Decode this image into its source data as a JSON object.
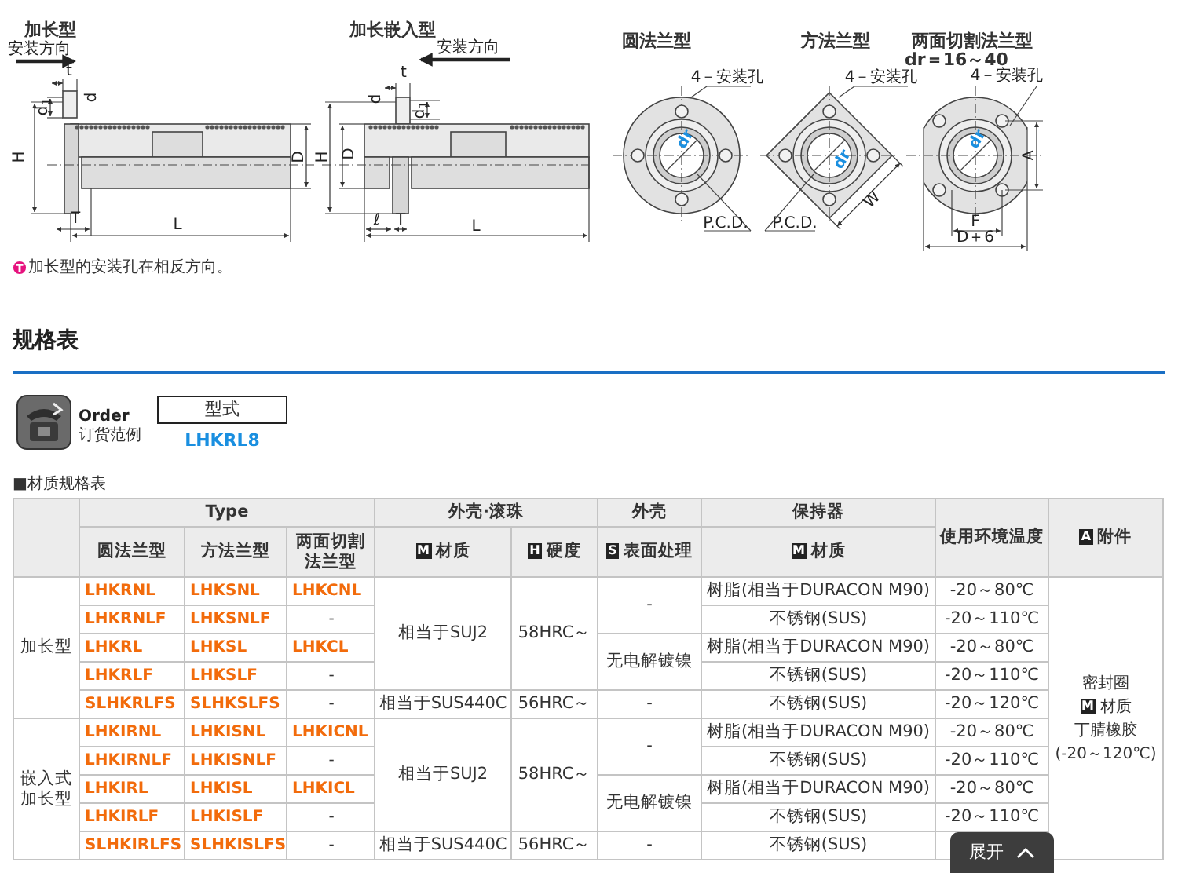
{
  "figures": [
    {
      "kind": "side",
      "title": "加长型",
      "direction": "安装方向",
      "labels": [
        "t",
        "d",
        "d$_{1}$",
        "H",
        "D",
        "T",
        "L"
      ]
    },
    {
      "kind": "embedded",
      "title": "加长嵌入型",
      "direction": "安装方向",
      "labels": [
        "t",
        "d",
        "d$_{1}$",
        "H",
        "D",
        "ℓ",
        "T",
        "L"
      ]
    },
    {
      "kind": "round",
      "title": "圆法兰型",
      "labels": [
        "4－安装孔",
        "dr",
        "P.C.D."
      ]
    },
    {
      "kind": "square",
      "title": "方法兰型",
      "labels": [
        "4－安装孔",
        "dr",
        "P.C.D.",
        "W"
      ]
    },
    {
      "kind": "cut",
      "title": "两面切割法兰型",
      "subtitle": "dr＝16～40",
      "labels": [
        "4－安装孔",
        "dr",
        "A",
        "F",
        "D＋6"
      ]
    }
  ],
  "note": "加长型的安装孔在相反方向。",
  "section_title": "规格表",
  "order": {
    "title": "Order",
    "subtitle": "订货范例",
    "field": "型式",
    "example": "LHKRL8"
  },
  "table_title": "■材质规格表",
  "header_top": [
    {
      "text": "Type"
    },
    {
      "text": "外壳·滚珠"
    },
    {
      "text": "外壳"
    },
    {
      "text": "保持器"
    },
    {
      "text": "使用环境温度"
    },
    {
      "badge": "A",
      "text": "附件"
    }
  ],
  "header_sub": [
    {
      "text": "圆法兰型"
    },
    {
      "text": "方法兰型"
    },
    {
      "text": "两面切割法兰型"
    },
    {
      "badge": "M",
      "text": "材质"
    },
    {
      "badge": "H",
      "text": "硬度"
    },
    {
      "badge": "S",
      "text": "表面处理"
    },
    {
      "badge": "M",
      "text": "材质"
    }
  ],
  "groups": [
    {
      "label": [
        "加长型"
      ],
      "rows": [
        [
          "LHKRNL",
          "LHKSNL",
          "LHKCNL",
          {
            "text": "相当于SUJ2",
            "rowspan": 4
          },
          {
            "text": "58HRC～",
            "rowspan": 4
          },
          {
            "text": "-",
            "rowspan": 2
          },
          "树脂(相当于DURACON M90)",
          "-20～80℃"
        ],
        [
          "LHKRNLF",
          "LHKSNLF",
          "-",
          "不锈钢(SUS)",
          "-20～110℃"
        ],
        [
          "LHKRL",
          "LHKSL",
          "LHKCL",
          {
            "text": "无电解镀镍",
            "rowspan": 2
          },
          "树脂(相当于DURACON M90)",
          "-20～80℃"
        ],
        [
          "LHKRLF",
          "LHKSLF",
          "-",
          "不锈钢(SUS)",
          "-20～110℃"
        ],
        [
          "SLHKRLFS",
          "SLHKSLFS",
          "-",
          "相当于SUS440C",
          "56HRC～",
          "-",
          "不锈钢(SUS)",
          "-20～120℃"
        ]
      ]
    },
    {
      "label": [
        "嵌入式",
        "加长型"
      ],
      "rows": [
        [
          "LHKIRNL",
          "LHKISNL",
          "LHKICNL",
          {
            "text": "相当于SUJ2",
            "rowspan": 4
          },
          {
            "text": "58HRC～",
            "rowspan": 4
          },
          {
            "text": "-",
            "rowspan": 2
          },
          "树脂(相当于DURACON M90)",
          "-20～80℃"
        ],
        [
          "LHKIRNLF",
          "LHKISNLF",
          "-",
          "不锈钢(SUS)",
          "-20～110℃"
        ],
        [
          "LHKIRL",
          "LHKISL",
          "LHKICL",
          {
            "text": "无电解镀镍",
            "rowspan": 2
          },
          "树脂(相当于DURACON M90)",
          "-20～80℃"
        ],
        [
          "LHKIRLF",
          "LHKISLF",
          "-",
          "不锈钢(SUS)",
          "-20～110℃"
        ],
        [
          "SLHKIRLFS",
          "SLHKISLFS",
          "-",
          "相当于SUS440C",
          "56HRC～",
          "-",
          "不锈钢(SUS)"
        ]
      ]
    }
  ],
  "accessory": {
    "name": "密封圈",
    "badge": "M",
    "label": "材质",
    "material": "丁腈橡胶",
    "range": "(-20～120℃)"
  },
  "expand_button": "展开"
}
